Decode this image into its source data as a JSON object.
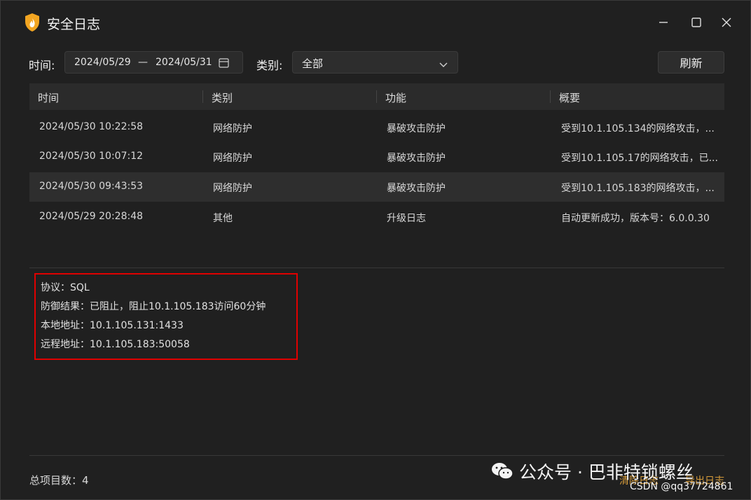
{
  "window": {
    "title": "安全日志"
  },
  "filters": {
    "time_label": "时间:",
    "start_date": "2024/05/29",
    "separator": "—",
    "end_date": "2024/05/31",
    "category_label": "类别:",
    "category_value": "全部",
    "refresh_label": "刷新"
  },
  "table": {
    "headers": [
      "时间",
      "类别",
      "功能",
      "概要"
    ],
    "rows": [
      {
        "time": "2024/05/30 10:22:58",
        "category": "网络防护",
        "function": "暴破攻击防护",
        "summary": "受到10.1.105.134的网络攻击，..."
      },
      {
        "time": "2024/05/30 10:07:12",
        "category": "网络防护",
        "function": "暴破攻击防护",
        "summary": "受到10.1.105.17的网络攻击，已..."
      },
      {
        "time": "2024/05/30 09:43:53",
        "category": "网络防护",
        "function": "暴破攻击防护",
        "summary": "受到10.1.105.183的网络攻击，..."
      },
      {
        "time": "2024/05/29 20:28:48",
        "category": "其他",
        "function": "升级日志",
        "summary": "自动更新成功，版本号：6.0.0.30"
      }
    ],
    "selected_row": 2
  },
  "detail": {
    "lines": [
      "协议：SQL",
      "防御结果：已阻止，阻止10.1.105.183访问60分钟",
      "本地地址：10.1.105.131:1433",
      "远程地址：10.1.105.183:50058"
    ]
  },
  "footer": {
    "count_label": "总项目数：",
    "count_value": "4",
    "clear_label": "清除日志",
    "export_label": "导出日志"
  },
  "watermark": {
    "text": "公众号 · 巴非特锁螺丝",
    "csdn": "CSDN @qq37724861"
  },
  "colors": {
    "background": "#202020",
    "highlight_border": "#e00000",
    "footer_link": "#d39a3a"
  }
}
